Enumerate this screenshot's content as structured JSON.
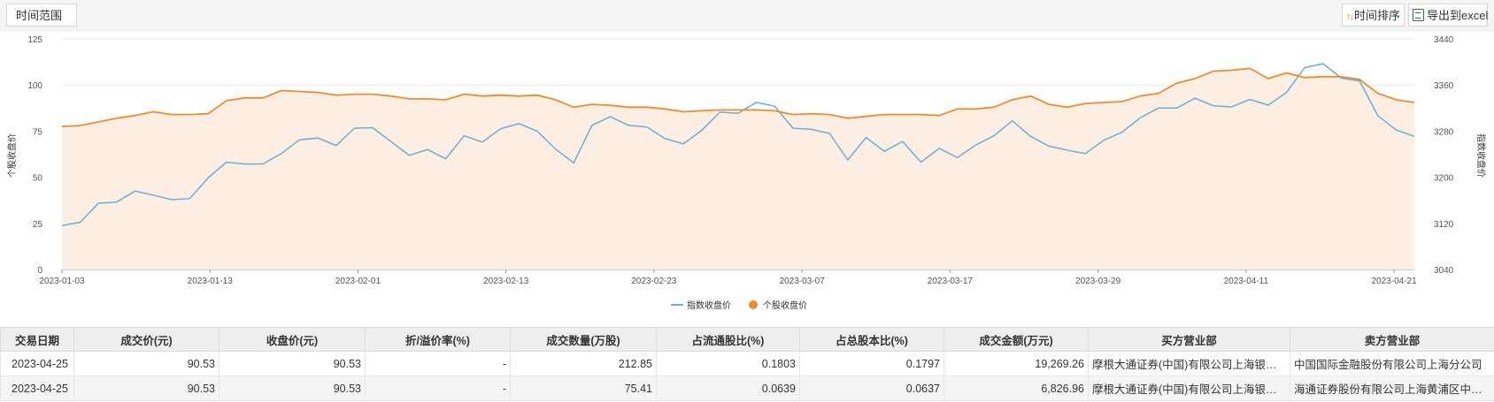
{
  "toolbar": {
    "range_label": "时间范围",
    "sort_label": "时间排序",
    "export_label": "导出到excel"
  },
  "chart_data": {
    "type": "line",
    "x_ticks": [
      "2023-01-03",
      "2023-01-13",
      "2023-02-01",
      "2023-02-13",
      "2023-02-23",
      "2023-03-07",
      "2023-03-17",
      "2023-03-29",
      "2023-04-11",
      "2023-04-21"
    ],
    "y_left": {
      "label": "个股收盘价",
      "range": [
        0,
        125
      ],
      "ticks": [
        "0",
        "25",
        "50",
        "75",
        "100",
        "125"
      ]
    },
    "y_right": {
      "label": "指数收盘价",
      "range": [
        3040,
        3440
      ],
      "ticks": [
        "3040",
        "3120",
        "3200",
        "3280",
        "3360",
        "3440"
      ]
    },
    "legend_position": "bottom",
    "series": [
      {
        "name": "指数收盘价",
        "axis": "right",
        "color": "#6aaed6",
        "values": [
          3116,
          3122,
          3155,
          3157,
          3176,
          3169,
          3161,
          3163,
          3199,
          3226,
          3223,
          3223,
          3241,
          3265,
          3268,
          3255,
          3285,
          3286,
          3262,
          3238,
          3248,
          3232,
          3272,
          3261,
          3284,
          3293,
          3280,
          3249,
          3225,
          3290,
          3305,
          3290,
          3287,
          3267,
          3258,
          3281,
          3313,
          3311,
          3330,
          3323,
          3285,
          3283,
          3276,
          3230,
          3269,
          3245,
          3262,
          3226,
          3250,
          3234,
          3256,
          3272,
          3298,
          3271,
          3254,
          3247,
          3241,
          3264,
          3278,
          3303,
          3320,
          3320,
          3337,
          3324,
          3322,
          3335,
          3325,
          3347,
          3390,
          3397,
          3372,
          3367,
          3307,
          3282,
          3271
        ]
      },
      {
        "name": "个股收盘价",
        "axis": "left",
        "color": "#f08c2e",
        "area_fill": "#fdeee3",
        "values": [
          77.5,
          78,
          80,
          82,
          83.5,
          85.5,
          84,
          84,
          84.5,
          91.5,
          93,
          93,
          97,
          96.5,
          96,
          94.5,
          95,
          95,
          94,
          92.5,
          92.5,
          92,
          95,
          94,
          94.5,
          94,
          94.5,
          92,
          88,
          89.5,
          89,
          88,
          88,
          87,
          85.5,
          86,
          86.5,
          86.5,
          86.5,
          86,
          84,
          84.5,
          84,
          82,
          83,
          84,
          84,
          84,
          83.5,
          87,
          87,
          88,
          92,
          94,
          89.5,
          88,
          90,
          90.5,
          91,
          94,
          95.5,
          101,
          103.5,
          107.5,
          108,
          109,
          103.5,
          106.5,
          104,
          104.5,
          104.5,
          103,
          95.5,
          92,
          90.53
        ]
      }
    ]
  },
  "table": {
    "columns": [
      "交易日期",
      "成交价(元)",
      "收盘价(元)",
      "折/溢价率(%)",
      "成交数量(万股)",
      "占流通股比(%)",
      "占总股本比(%)",
      "成交金额(万元)",
      "买方营业部",
      "卖方营业部"
    ],
    "rows": [
      [
        "2023-04-25",
        "90.53",
        "90.53",
        "-",
        "212.85",
        "0.1803",
        "0.1797",
        "19,269.26",
        "摩根大通证券(中国)有限公司上海银城中路证券营业部",
        "中国国际金融股份有限公司上海分公司"
      ],
      [
        "2023-04-25",
        "90.53",
        "90.53",
        "-",
        "75.41",
        "0.0639",
        "0.0637",
        "6,826.96",
        "摩根大通证券(中国)有限公司上海银城中路证券营业部",
        "海通证券股份有限公司上海黄浦区中山南路证券营业部"
      ]
    ]
  }
}
